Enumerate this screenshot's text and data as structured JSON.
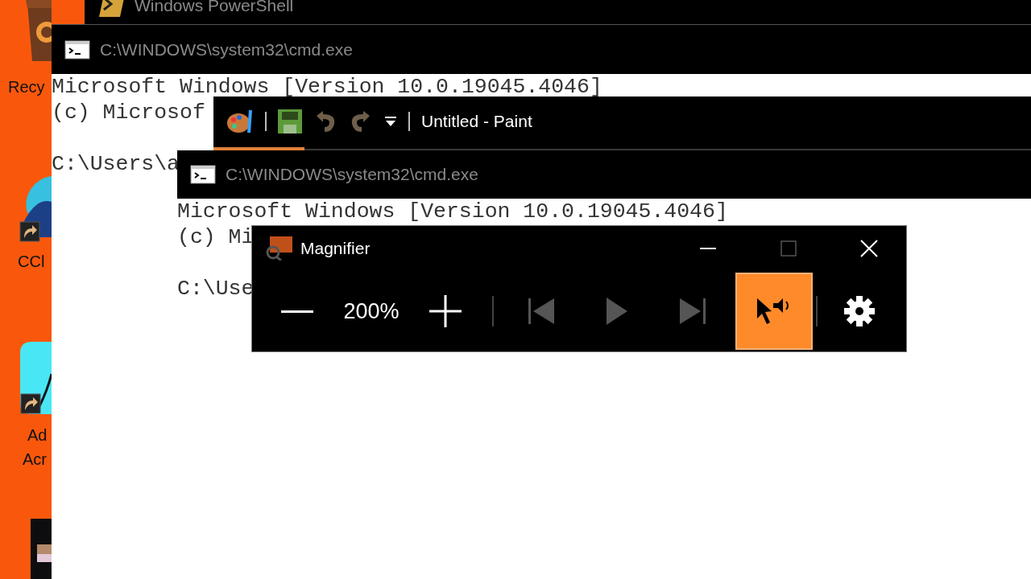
{
  "desktop_icons": [
    {
      "kind": "recycle-bin",
      "lines": [
        "Recy"
      ]
    },
    {
      "kind": "ccleaner",
      "lines": [
        "CCl"
      ]
    },
    {
      "kind": "acrobat",
      "lines": [
        "Ad",
        "Acr"
      ]
    },
    {
      "kind": "media"
    }
  ],
  "powershell_window": {
    "title": "Windows PowerShell"
  },
  "cmd_window_back": {
    "title": "C:\\WINDOWS\\system32\\cmd.exe",
    "active": false,
    "paragraphs": [
      [
        "Microsoft Windows [Version 10.0.19045.4046]",
        "(c) Microsof"
      ],
      [
        "C:\\Users\\a"
      ]
    ]
  },
  "paint_window": {
    "title": "Untitled - Paint"
  },
  "cmd_window_front": {
    "title": "C:\\WINDOWS\\system32\\cmd.exe",
    "active": false,
    "paragraphs": [
      [
        "Microsoft Windows [Version 10.0.19045.4046]",
        "(c) Mi"
      ],
      [
        "C:\\Use"
      ]
    ]
  },
  "magnifier": {
    "title": "Magnifier",
    "zoom": "200%",
    "reading_controls": [
      {
        "kind": "previous",
        "disabled": true
      },
      {
        "kind": "play",
        "disabled": true
      },
      {
        "kind": "next",
        "disabled": true
      }
    ],
    "read_from_pointer": {
      "on": true
    }
  }
}
